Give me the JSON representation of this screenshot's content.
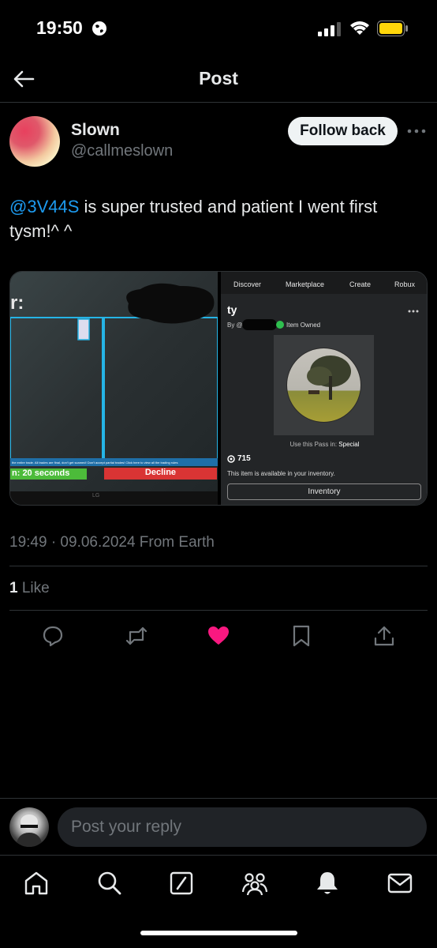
{
  "status_bar": {
    "time": "19:50"
  },
  "header": {
    "title": "Post"
  },
  "post": {
    "author_name": "Slown",
    "author_handle": "@callmeslown",
    "follow_label": "Follow back",
    "mention": "@3V44S",
    "text_rest": " is super trusted and patient I went first tysm!^ ^",
    "timestamp": "19:49 · 09.06.2024 From Earth",
    "likes_count": "1",
    "likes_label": " Like"
  },
  "media_left": {
    "partial_title": "r:",
    "trade_notice": "the entire trade. All trades are final, don't get scamed! Don't accept partial trades! Click here to view all the trading rules",
    "timer": "n: 20 seconds",
    "decline": "Decline",
    "brand": "LG"
  },
  "media_right": {
    "nav": [
      "Discover",
      "Marketplace",
      "Create",
      "Robux"
    ],
    "item_title": "ty",
    "by_prefix": "By @",
    "owned_label": "Item Owned",
    "use_pass_prefix": "Use this Pass in: ",
    "use_pass_place": "Special",
    "price": "715",
    "available_text": "This item is available in your inventory.",
    "inventory_button": "Inventory"
  },
  "reply": {
    "placeholder": "Post your reply"
  },
  "tabs": [
    "home-icon",
    "search-icon",
    "grok-icon",
    "communities-icon",
    "notifications-icon",
    "messages-icon"
  ],
  "colors": {
    "accent": "#1d9bf0",
    "like": "#f91880",
    "background": "#000000",
    "muted": "#71767b"
  }
}
